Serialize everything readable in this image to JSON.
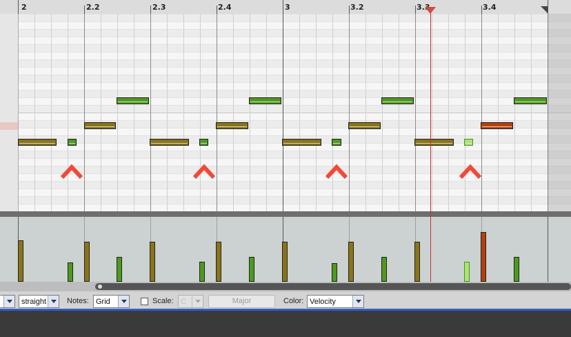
{
  "ruler": {
    "labels": [
      "2",
      "2.2",
      "2.3",
      "2.4",
      "3",
      "3.2",
      "3.3",
      "3.4"
    ]
  },
  "colors": {
    "note_olive": "#8a7418",
    "note_green": "#4d9a1e",
    "note_selected": "#a6e86c",
    "note_red": "#b5400d",
    "caret": "#f04a3a",
    "cursor": "#c0312c"
  },
  "icons": {
    "caret": "caret-up-icon",
    "checkbox": "checkbox-icon",
    "dropdown": "chevron-down-icon"
  },
  "toolbar": {
    "swing_value": "straight",
    "notes_label": "Notes:",
    "notes_value": "Grid",
    "scale_label": "Scale:",
    "scale_key_value": "C",
    "scale_mode_label": "Major",
    "color_label": "Color:",
    "color_value": "Velocity"
  }
}
